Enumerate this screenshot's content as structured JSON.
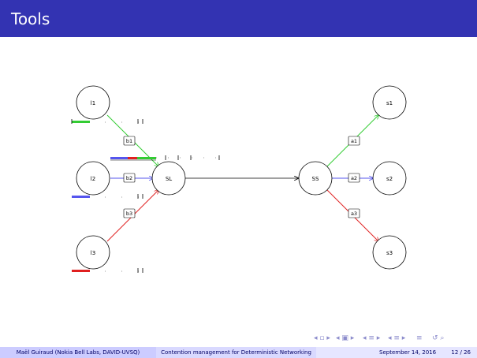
{
  "slide": {
    "title": "Tools"
  },
  "diagram": {
    "nodes": {
      "l1": "l1",
      "l2": "l2",
      "l3": "l3",
      "SL": "SL",
      "SS": "SS",
      "s1": "s1",
      "s2": "s2",
      "s3": "s3"
    },
    "labels": {
      "b1": "b1",
      "b2": "b2",
      "b3": "b3",
      "a1": "a1",
      "a2": "a2",
      "a3": "a3"
    },
    "colors": {
      "flow1": "#33cc33",
      "flow2": "#5555ee",
      "flow3": "#e02020",
      "edge": "#000000"
    }
  },
  "footer": {
    "author": "Maël Guiraud   (Nokia Bell Labs, DAVID-UVSQ)",
    "talk_title": "Contention management for Deterministic Networking",
    "date": "September 14, 2016",
    "page": "12 / 26"
  },
  "navigation": {
    "icons": [
      "nav-slide-prev-icon",
      "nav-frame-prev-icon",
      "nav-section-prev-icon",
      "nav-subsection-prev-icon",
      "nav-align-icon",
      "nav-search-icon"
    ]
  }
}
